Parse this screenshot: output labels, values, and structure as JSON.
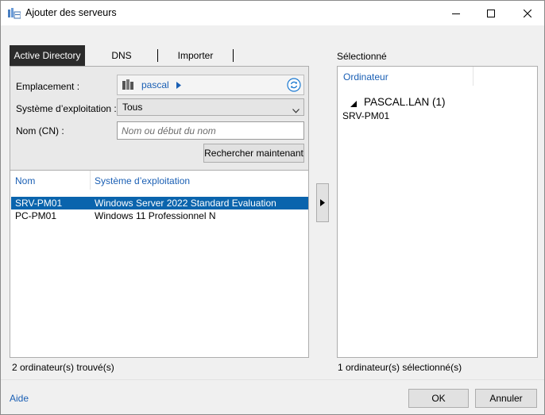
{
  "window": {
    "title": "Ajouter des serveurs"
  },
  "tabs": [
    {
      "label": "Active Directory",
      "active": true
    },
    {
      "label": "DNS",
      "active": false
    },
    {
      "label": "Importer",
      "active": false
    }
  ],
  "search": {
    "location_label": "Emplacement :",
    "location_value": "pascal",
    "os_label": "Système d’exploitation :",
    "os_value": "Tous",
    "cn_label": "Nom (CN) :",
    "cn_placeholder": "Nom ou début du nom",
    "cn_value": "",
    "search_button": "Rechercher maintenant"
  },
  "results": {
    "columns": [
      "Nom",
      "Système d’exploitation"
    ],
    "rows": [
      {
        "name": "SRV-PM01",
        "os": "Windows Server 2022 Standard Evaluation",
        "selected": true
      },
      {
        "name": "PC-PM01",
        "os": "Windows 11 Professionnel N",
        "selected": false
      }
    ],
    "found_text": "2 ordinateur(s) trouvé(s)"
  },
  "selected": {
    "label": "Sélectionné",
    "column": "Ordinateur",
    "group": "PASCAL.LAN (1)",
    "items": [
      "SRV-PM01"
    ],
    "count_text": "1 ordinateur(s) sélectionné(s)"
  },
  "footer": {
    "help": "Aide",
    "ok": "OK",
    "cancel": "Annuler"
  },
  "icons": {
    "app": "server-manager-icon",
    "location": "server-stack-icon",
    "refresh": "refresh-icon",
    "move": "arrow-right-icon",
    "expand": "triangle-expanded-icon"
  },
  "colors": {
    "accent": "#0a64ad",
    "link": "#1a5fb4",
    "active_tab": "#2b2b2b"
  }
}
